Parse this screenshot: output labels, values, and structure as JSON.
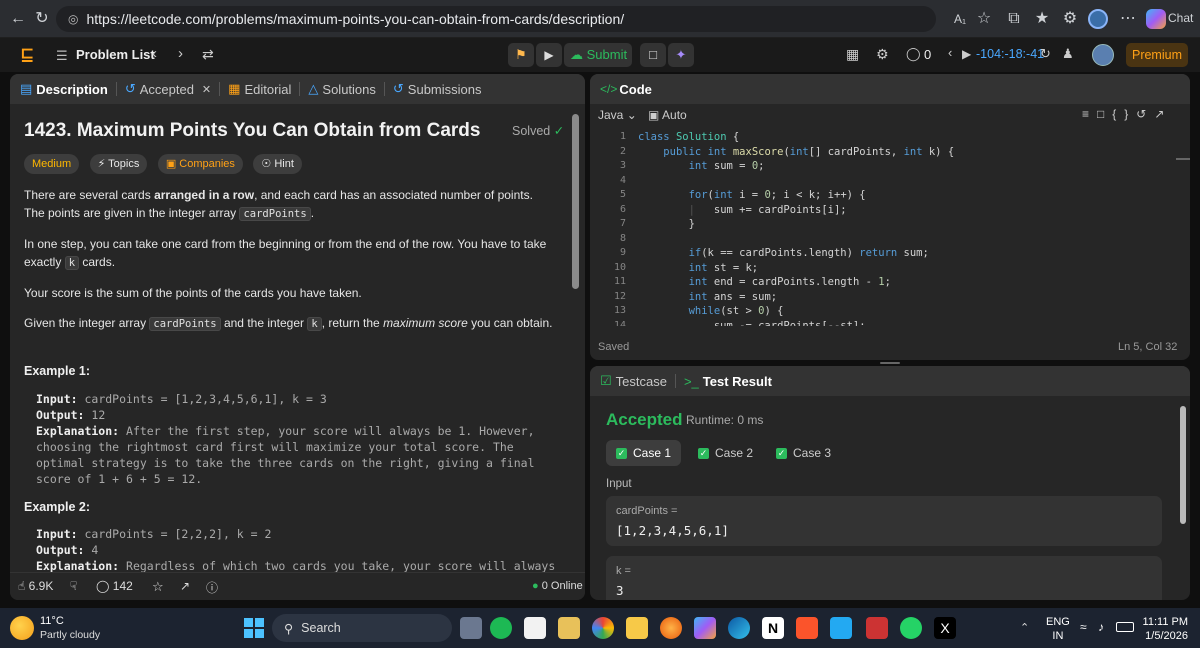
{
  "browser": {
    "url": "https://leetcode.com/problems/maximum-points-you-can-obtain-from-cards/description/",
    "copilot_label": "Chat"
  },
  "topbar": {
    "problem_list": "Problem List",
    "submit_label": "Submit",
    "streak_count": "0",
    "timer": "-104:-18:-41",
    "premium": "Premium"
  },
  "left_tabs": [
    "Description",
    "Accepted",
    "Editorial",
    "Solutions",
    "Submissions"
  ],
  "problem": {
    "title": "1423. Maximum Points You Can Obtain from Cards",
    "status": "Solved",
    "difficulty": "Medium",
    "tags": [
      "Topics",
      "Companies",
      "Hint"
    ],
    "p1a": "There are several cards ",
    "p1b": "arranged in a row",
    "p1c": ", and each card has an associated number of points. The points are given in the integer array ",
    "p1code": "cardPoints",
    "p1d": ".",
    "p2a": "In one step, you can take one card from the beginning or from the end of the row. You have to take exactly ",
    "p2code": "k",
    "p2b": " cards.",
    "p3": "Your score is the sum of the points of the cards you have taken.",
    "p4a": "Given the integer array ",
    "p4code": "cardPoints",
    "p4b": " and the integer ",
    "p4code2": "k",
    "p4c": ", return the ",
    "p4em": "maximum score",
    "p4d": " you can obtain.",
    "ex1_title": "Example 1:",
    "ex1_input_label": "Input:",
    "ex1_input": " cardPoints = [1,2,3,4,5,6,1], k = 3",
    "ex1_output_label": "Output:",
    "ex1_output": " 12",
    "ex1_expl_label": "Explanation:",
    "ex1_expl": " After the first step, your score will always be 1. However, choosing the rightmost card first will maximize your total score. The optimal strategy is to take the three cards on the right, giving a final score of 1 + 6 + 5 = 12.",
    "ex2_title": "Example 2:",
    "ex2_input_label": "Input:",
    "ex2_input": " cardPoints = [2,2,2], k = 2",
    "ex2_output_label": "Output:",
    "ex2_output": " 4",
    "ex2_expl_label": "Explanation:",
    "ex2_expl": " Regardless of which two cards you take, your score will always be"
  },
  "footer": {
    "likes": "6.9K",
    "comments": "142",
    "online": "0 Online"
  },
  "code_panel": {
    "title": "Code",
    "language": "Java",
    "mode": "Auto",
    "saved": "Saved",
    "cursor": "Ln 5, Col 32",
    "line_numbers": [
      "1",
      "2",
      "3",
      "4",
      "5",
      "6",
      "7",
      "8",
      "9",
      "10",
      "11",
      "12",
      "13",
      "14"
    ]
  },
  "test_panel": {
    "tab1": "Testcase",
    "tab2": "Test Result",
    "result": "Accepted",
    "runtime": "Runtime: 0 ms",
    "cases": [
      "Case 1",
      "Case 2",
      "Case 3"
    ],
    "input_label": "Input",
    "var1_name": "cardPoints =",
    "var1_value": "[1,2,3,4,5,6,1]",
    "var2_name": "k =",
    "var2_value": "3"
  },
  "taskbar": {
    "temp": "11°C",
    "weather": "Partly cloudy",
    "search": "Search",
    "lang1": "ENG",
    "lang2": "IN",
    "time": "11:11 PM",
    "date": "1/5/2026"
  }
}
